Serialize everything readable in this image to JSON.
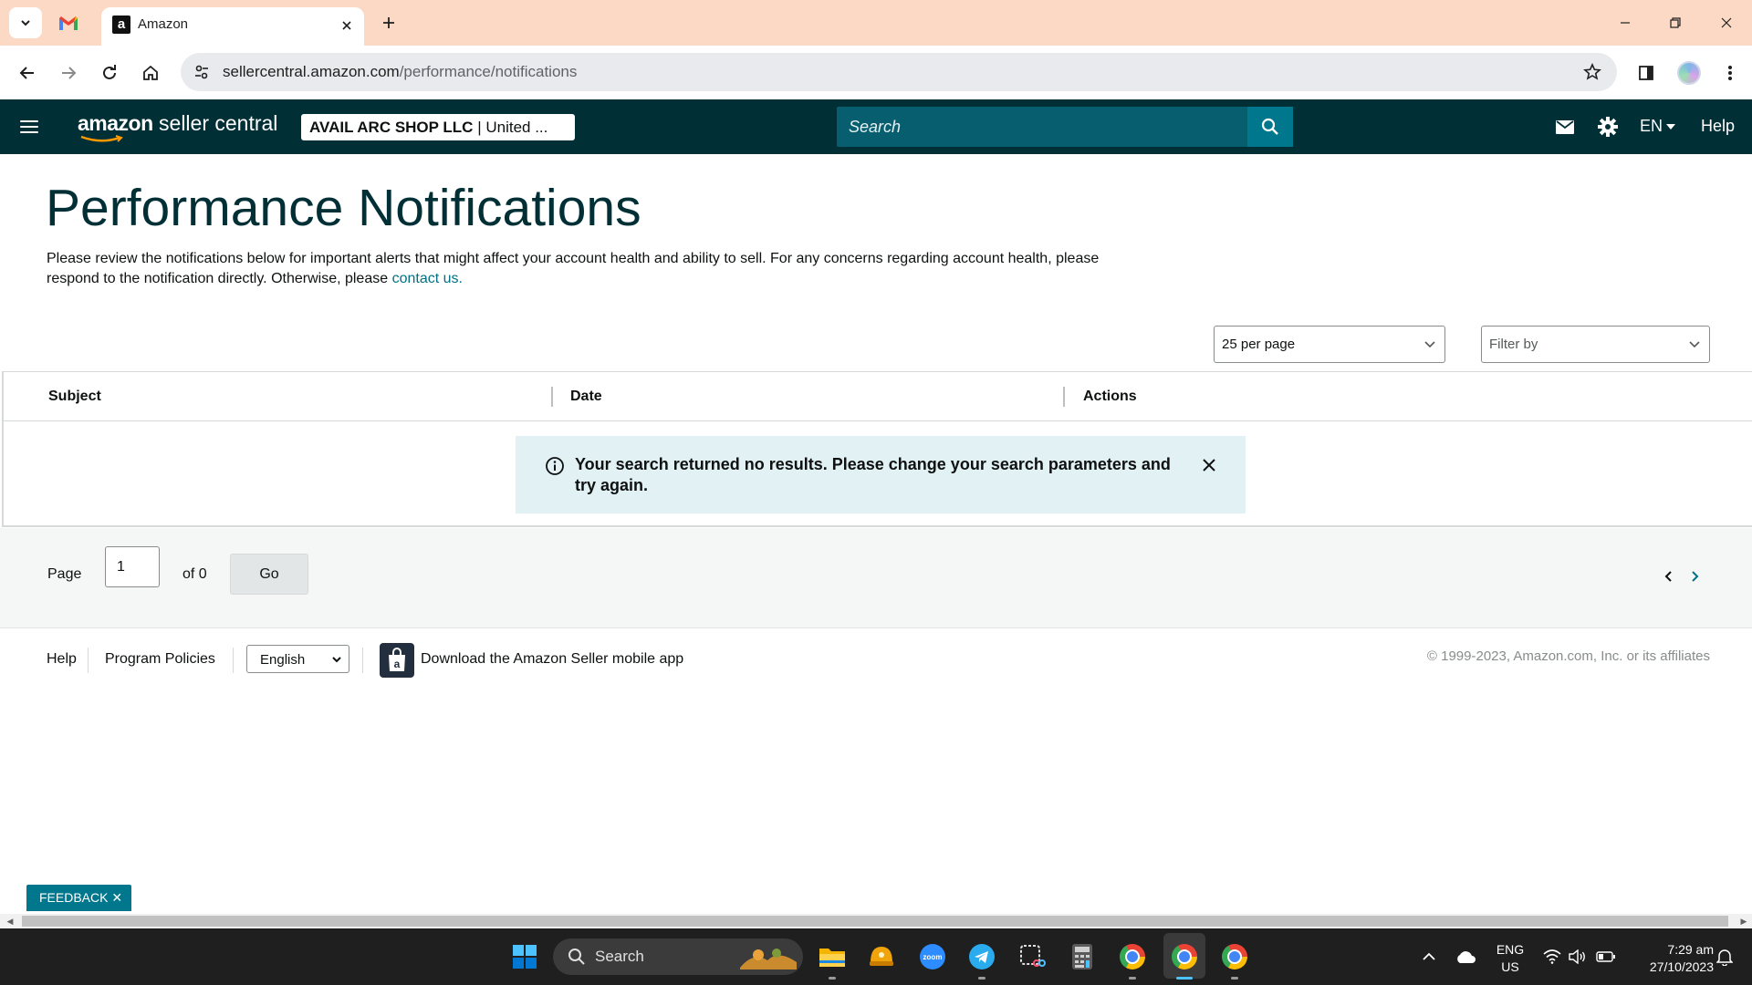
{
  "browser": {
    "tab_title": "Amazon",
    "url_domain": "sellercentral.amazon.com",
    "url_path": "/performance/notifications"
  },
  "header": {
    "logo_brand": "amazon",
    "logo_product": " seller central",
    "account_name": "AVAIL ARC SHOP LLC",
    "account_region": " | United ...",
    "search_placeholder": "Search",
    "language": "EN",
    "help": "Help"
  },
  "page": {
    "title": "Performance Notifications",
    "description": "Please review the notifications below for important alerts that might affect your account health and ability to sell. For any concerns regarding account health, please respond to the notification directly. Otherwise, please ",
    "contact_link": "contact us."
  },
  "filters": {
    "per_page": "25 per page",
    "filter_placeholder": "Filter by"
  },
  "table": {
    "columns": [
      "Subject",
      "Date",
      "Actions"
    ],
    "empty_message": "Your search returned no results. Please change your search parameters and try again."
  },
  "pagination": {
    "page_label": "Page",
    "current_page": "1",
    "of_label": "of 0",
    "go_label": "Go"
  },
  "footer": {
    "help": "Help",
    "program_policies": "Program Policies",
    "language": "English",
    "app_download": "Download the Amazon Seller mobile app",
    "copyright": "© 1999-2023, Amazon.com, Inc. or its affiliates"
  },
  "feedback": "FEEDBACK ✕",
  "taskbar": {
    "search_label": "Search",
    "lang_top": "ENG",
    "lang_bottom": "US",
    "time": "7:29 am",
    "date": "27/10/2023"
  },
  "colors": {
    "header_bg": "#002f36",
    "accent": "#00778c",
    "link": "#007185",
    "alert_bg": "#e1f1f4"
  }
}
